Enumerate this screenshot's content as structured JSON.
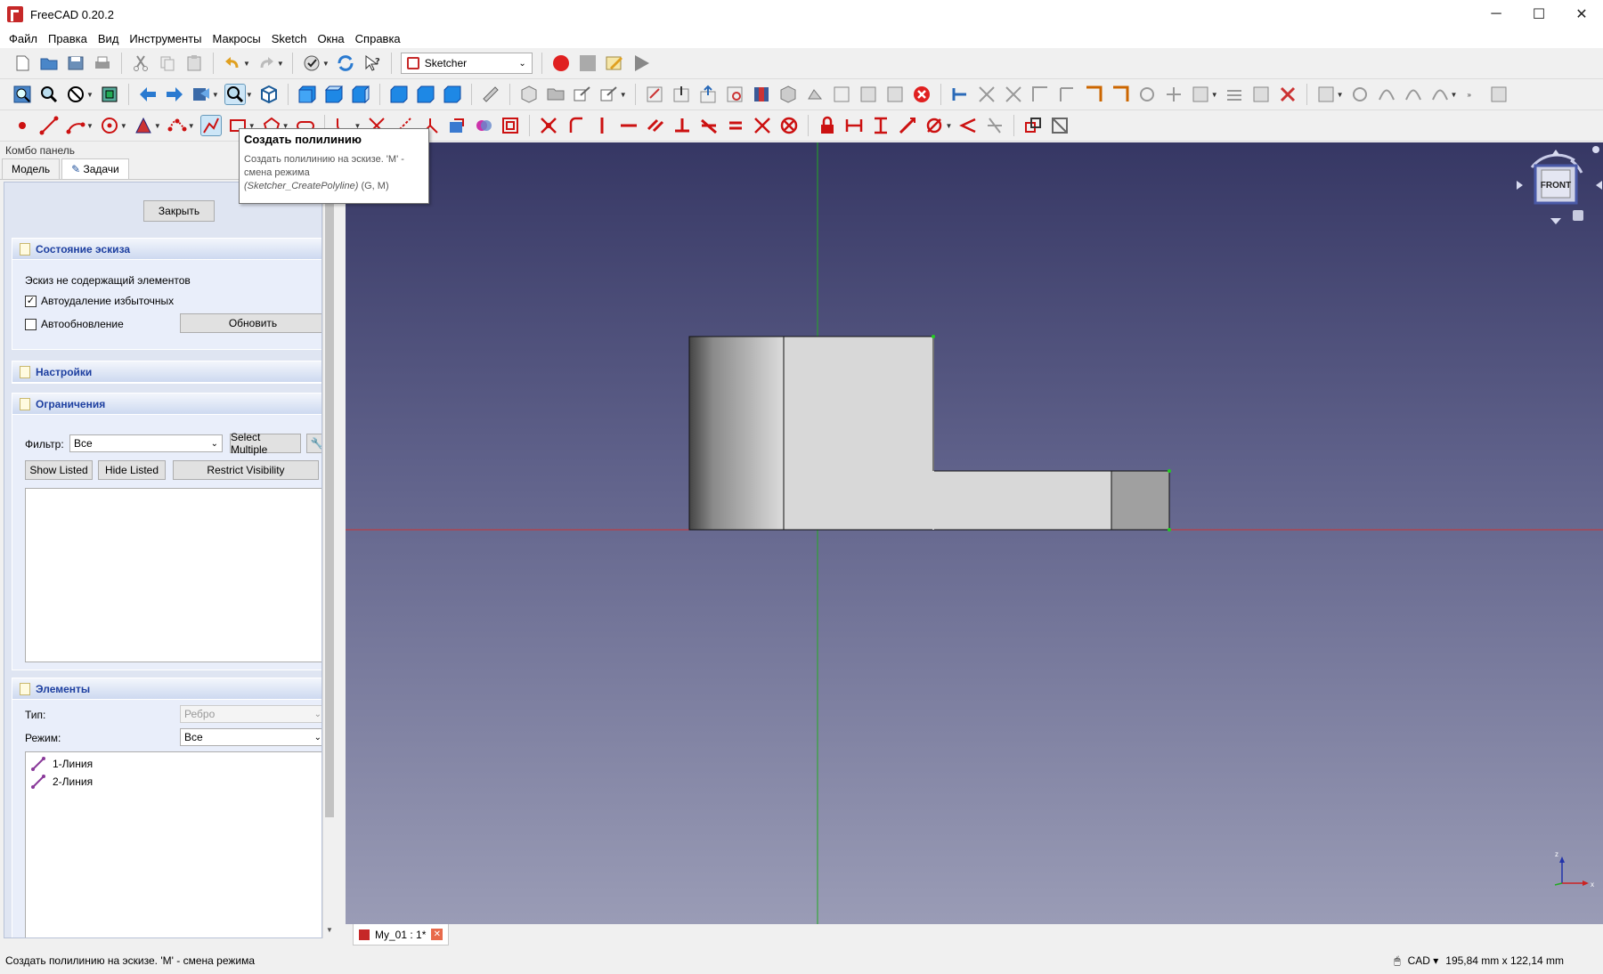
{
  "window": {
    "title": "FreeCAD 0.20.2",
    "minimize": "─",
    "maximize": "☐",
    "close": "✕"
  },
  "menu": [
    "Файл",
    "Правка",
    "Вид",
    "Инструменты",
    "Макросы",
    "Sketch",
    "Окна",
    "Справка"
  ],
  "toolbar": {
    "workbench": "Sketcher"
  },
  "combo": {
    "title": "Комбо панель",
    "tabs": [
      "Модель",
      "Задачи"
    ],
    "close_button": "Закрыть"
  },
  "sketch_state": {
    "header": "Состояние эскиза",
    "message": "Эскиз не содержащий элементов",
    "auto_remove": "Автоудаление избыточных",
    "auto_update": "Автообновление",
    "update_button": "Обновить"
  },
  "settings": {
    "header": "Настройки"
  },
  "constraints": {
    "header": "Ограничения",
    "filter_label": "Фильтр:",
    "filter_value": "Все",
    "select_multiple": "Select Multiple",
    "show_listed": "Show Listed",
    "hide_listed": "Hide Listed",
    "restrict_visibility": "Restrict Visibility"
  },
  "elements": {
    "header": "Элементы",
    "type_label": "Тип:",
    "type_value": "Ребро",
    "mode_label": "Режим:",
    "mode_value": "Все",
    "items": [
      "1-Линия",
      "2-Линия"
    ]
  },
  "tooltip": {
    "title": "Создать полилинию",
    "line1": "Создать полилинию на эскизе. 'M' -",
    "line2": "смена режима",
    "command": "(Sketcher_CreatePolyline)",
    "shortcut": " (G, M)"
  },
  "navcube": {
    "face": "FRONT"
  },
  "document_tab": {
    "label": "My_01 : 1*"
  },
  "status": {
    "message": "Создать полилинию на эскизе. 'M' - смена режима",
    "nav_style": "CAD",
    "dimensions": "195,84 mm x 122,14 mm"
  },
  "colors": {
    "sketch_red": "#cc1111",
    "accent_blue": "#1d3fa0",
    "axis_green": "#22aa22",
    "axis_red": "#cc3333"
  }
}
